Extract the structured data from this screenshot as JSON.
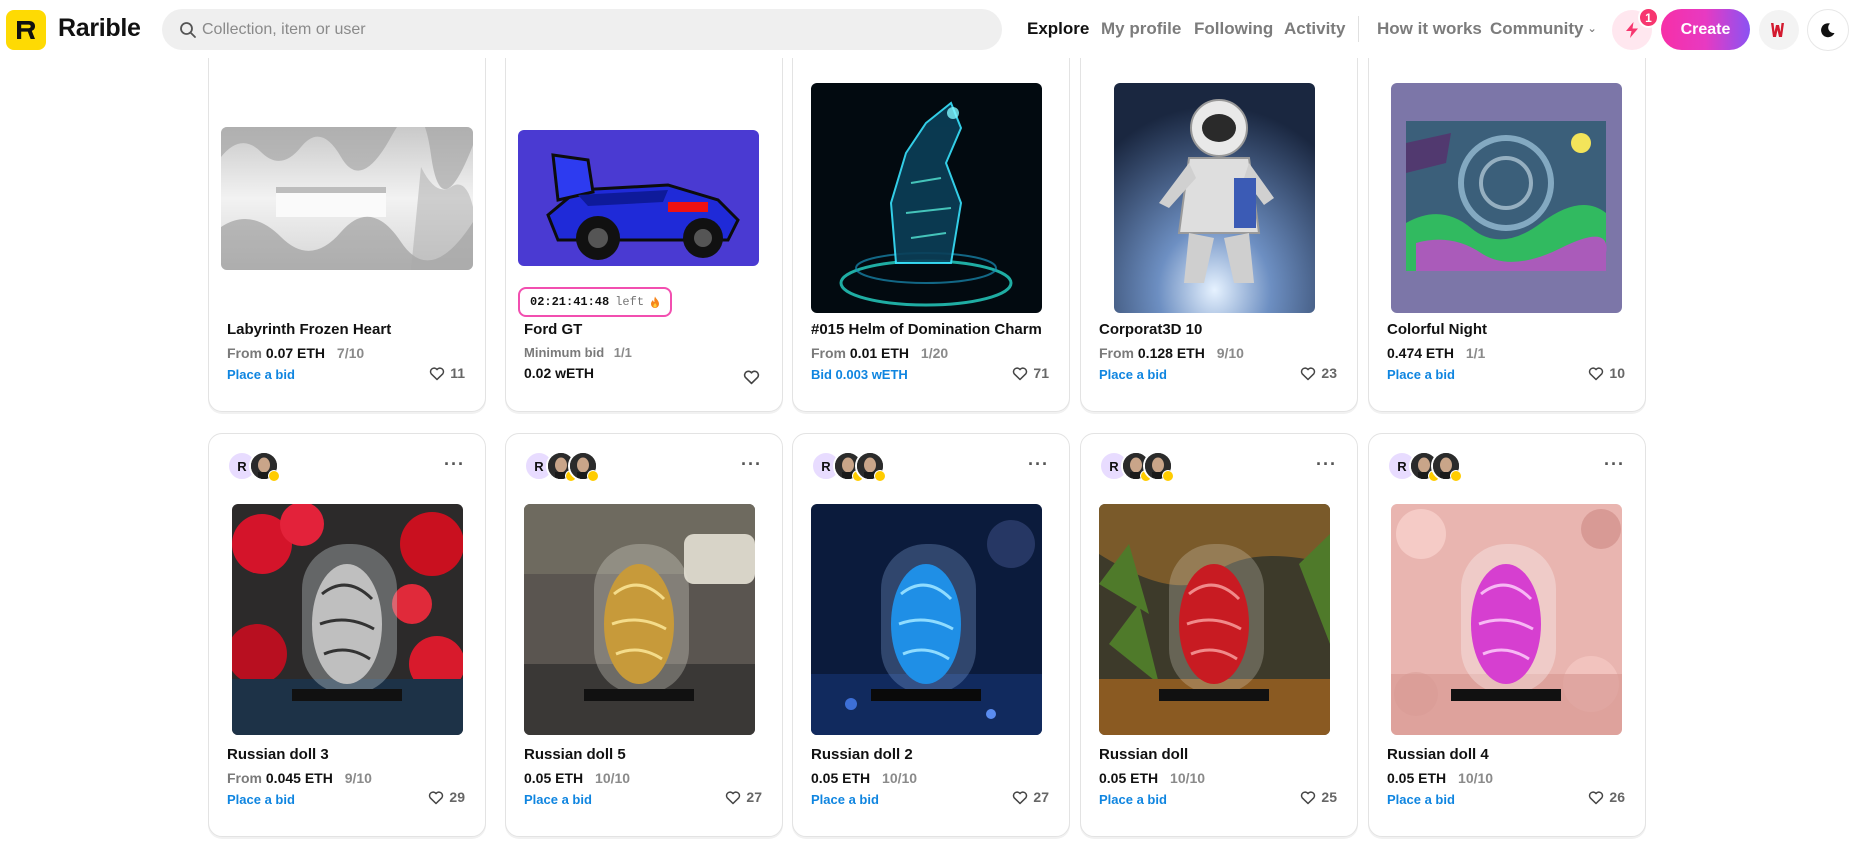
{
  "brand": {
    "name": "Rarible"
  },
  "search": {
    "placeholder": "Collection, item or user"
  },
  "nav": {
    "explore": "Explore",
    "my_profile": "My profile",
    "following": "Following",
    "activity": "Activity",
    "how_it_works": "How it works",
    "community": "Community"
  },
  "header": {
    "notification_count": "1",
    "create_label": "Create"
  },
  "colors": {
    "brand_yellow": "#feda03",
    "link_blue": "#0f85e0",
    "accent_pink": "#f72fa7"
  },
  "row1": [
    {
      "title": "Labyrinth Frozen Heart",
      "price_prefix": "From",
      "price": "0.07 ETH",
      "edition": "7/10",
      "action": "Place a bid",
      "likes": "11"
    },
    {
      "title": "Ford GT",
      "timer": "02:21:41:48",
      "timer_suffix": "left",
      "price_prefix": "Minimum bid",
      "edition": "1/1",
      "min_bid_value": "0.02 wETH"
    },
    {
      "title": "#015 Helm of Domination Charm",
      "price_prefix": "From",
      "price": "0.01 ETH",
      "edition": "1/20",
      "action": "Bid 0.003 wETH",
      "likes": "71"
    },
    {
      "title": "Corporat3D 10",
      "price_prefix": "From",
      "price": "0.128 ETH",
      "edition": "9/10",
      "action": "Place a bid",
      "likes": "23"
    },
    {
      "title": "Colorful Night",
      "price": "0.474 ETH",
      "edition": "1/1",
      "action": "Place a bid",
      "likes": "10"
    }
  ],
  "row2": [
    {
      "title": "Russian doll 3",
      "price_prefix": "From",
      "price": "0.045 ETH",
      "edition": "9/10",
      "action": "Place a bid",
      "likes": "29",
      "avatar_letter": "R"
    },
    {
      "title": "Russian doll 5",
      "price": "0.05 ETH",
      "edition": "10/10",
      "action": "Place a bid",
      "likes": "27",
      "avatar_letter": "R"
    },
    {
      "title": "Russian doll 2",
      "price": "0.05 ETH",
      "edition": "10/10",
      "action": "Place a bid",
      "likes": "27",
      "avatar_letter": "R"
    },
    {
      "title": "Russian doll",
      "price": "0.05 ETH",
      "edition": "10/10",
      "action": "Place a bid",
      "likes": "25",
      "avatar_letter": "R"
    },
    {
      "title": "Russian doll 4",
      "price": "0.05 ETH",
      "edition": "10/10",
      "action": "Place a bid",
      "likes": "26",
      "avatar_letter": "R"
    }
  ],
  "more_label": "···"
}
